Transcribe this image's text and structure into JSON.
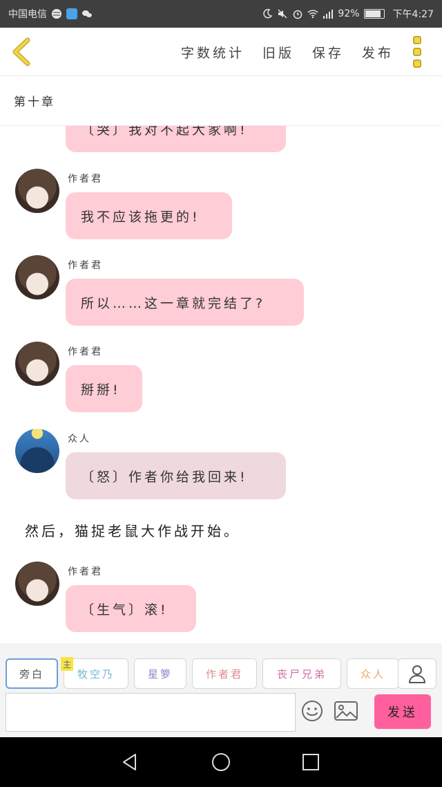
{
  "status_bar": {
    "carrier": "中国电信",
    "battery_percent": "92%",
    "battery_level": 0.92,
    "time": "下午4:27"
  },
  "toolbar": {
    "word_count": "字数统计",
    "old_version": "旧版",
    "save": "保存",
    "publish": "发布"
  },
  "chapter": {
    "title": "第十章"
  },
  "messages": [
    {
      "speaker": "",
      "text": "〔哭〕我对不起大家啊!"
    },
    {
      "speaker": "作者君",
      "text": "我不应该拖更的!"
    },
    {
      "speaker": "作者君",
      "text": "所以……这一章就完结了?"
    },
    {
      "speaker": "作者君",
      "text": "掰掰!"
    },
    {
      "speaker": "众人",
      "text": "〔怒〕作者你给我回来!"
    },
    {
      "narration": "然后，猫捉老鼠大作战开始。"
    },
    {
      "speaker": "作者君",
      "text": "〔生气〕滚!"
    }
  ],
  "characters": {
    "main_tag": "主",
    "items": [
      {
        "label": "旁白",
        "color": "#555555"
      },
      {
        "label": "牧空乃",
        "color": "#6fb8d8"
      },
      {
        "label": "星箩",
        "color": "#9a7fd0"
      },
      {
        "label": "作者君",
        "color": "#e08a8a"
      },
      {
        "label": "丧尸兄弟",
        "color": "#d06aa8"
      },
      {
        "label": "众人",
        "color": "#e8a868"
      }
    ]
  },
  "input": {
    "placeholder": "",
    "value": "",
    "send_label": "发送"
  },
  "colors": {
    "bubble_pink": "#ffcdd6",
    "bubble_grey": "#efd9dd",
    "send_button": "#ff5f9c",
    "accent_yellow": "#f2d64a"
  }
}
